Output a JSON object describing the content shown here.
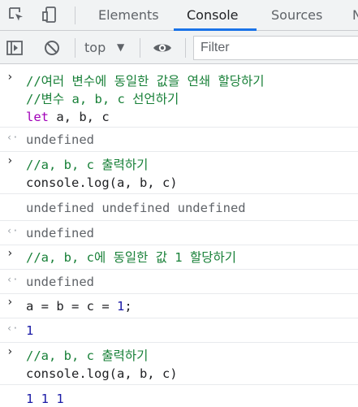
{
  "tabs": [
    "Elements",
    "Console",
    "Sources",
    "N"
  ],
  "active_tab": "Console",
  "toolbar": {
    "context": "top",
    "context_arrow": "▼",
    "filter_placeholder": "Filter"
  },
  "glyphs": {
    "input": "›",
    "output": "‹·"
  },
  "console": {
    "e1": {
      "c1": "//여러 변수에 동일한 값을 연쇄 할당하기",
      "c2": "//변수 a, b, c 선언하기",
      "kw": "let",
      "rest": " a, b, c"
    },
    "r1": "undefined",
    "e2": {
      "c1": "//a, b, c 출력하기",
      "code": "console.log(a, b, c)"
    },
    "log2": "undefined undefined undefined",
    "r2": "undefined",
    "e3": {
      "c1": "//a, b, c에 동일한 값 1 할당하기"
    },
    "r3": "undefined",
    "e4": {
      "pre": "a = b = c = ",
      "num": "1",
      "post": ";"
    },
    "r4": "1",
    "e5": {
      "c1": "//a, b, c 출력하기",
      "code": "console.log(a, b, c)"
    },
    "log5": "1 1 1"
  }
}
